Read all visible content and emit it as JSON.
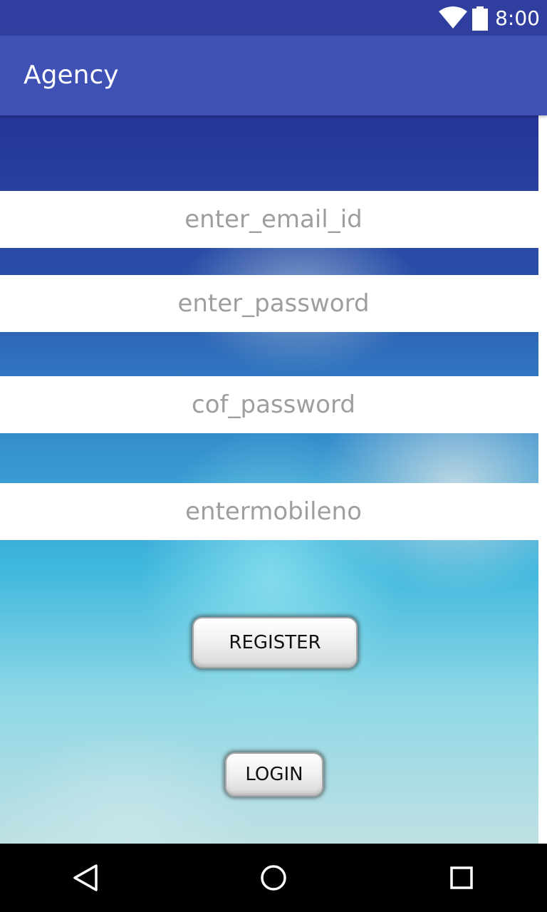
{
  "status_bar": {
    "time": "8:00",
    "icons": [
      "wifi-icon",
      "battery-icon"
    ]
  },
  "app_bar": {
    "title": "Agency",
    "color": "#3f51b5"
  },
  "form": {
    "email_placeholder": "enter_email_id",
    "password_placeholder": "enter_password",
    "confirm_password_placeholder": "cof_password",
    "mobile_placeholder": "entermobileno"
  },
  "buttons": {
    "register_label": "REGISTER",
    "login_label": "LOGIN"
  },
  "navigation": {
    "icons": [
      "back-icon",
      "home-icon",
      "recents-icon"
    ]
  },
  "colors": {
    "status_bar": "#303f9f",
    "app_bar": "#3f51b5",
    "placeholder": "#9e9e9e"
  }
}
